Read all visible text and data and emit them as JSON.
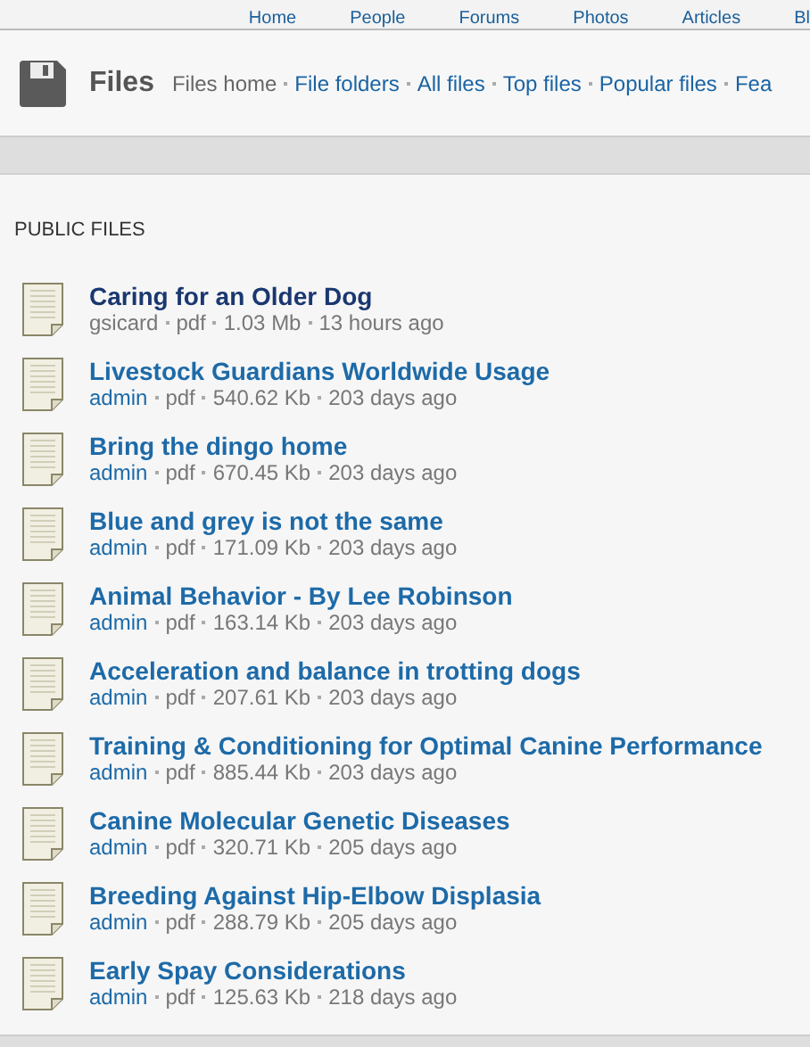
{
  "top_nav": [
    "Home",
    "People",
    "Forums",
    "Photos",
    "Articles",
    "Bl"
  ],
  "header": {
    "title": "Files",
    "links": [
      {
        "label": "Files home",
        "selected": true
      },
      {
        "label": "File folders",
        "selected": false
      },
      {
        "label": "All files",
        "selected": false
      },
      {
        "label": "Top files",
        "selected": false
      },
      {
        "label": "Popular files",
        "selected": false
      },
      {
        "label": "Fea",
        "selected": false
      }
    ]
  },
  "section_title": "PUBLIC FILES",
  "files": [
    {
      "title": "Caring for an Older Dog",
      "visited": true,
      "author": "gsicard",
      "author_link": false,
      "type": "pdf",
      "size": "1.03 Mb",
      "age": "13 hours ago"
    },
    {
      "title": "Livestock Guardians Worldwide Usage",
      "visited": false,
      "author": "admin",
      "author_link": true,
      "type": "pdf",
      "size": "540.62 Kb",
      "age": "203 days ago"
    },
    {
      "title": "Bring the dingo home",
      "visited": false,
      "author": "admin",
      "author_link": true,
      "type": "pdf",
      "size": "670.45 Kb",
      "age": "203 days ago"
    },
    {
      "title": "Blue and grey is not the same",
      "visited": false,
      "author": "admin",
      "author_link": true,
      "type": "pdf",
      "size": "171.09 Kb",
      "age": "203 days ago"
    },
    {
      "title": "Animal Behavior - By Lee Robinson",
      "visited": false,
      "author": "admin",
      "author_link": true,
      "type": "pdf",
      "size": "163.14 Kb",
      "age": "203 days ago"
    },
    {
      "title": "Acceleration and balance in trotting dogs",
      "visited": false,
      "author": "admin",
      "author_link": true,
      "type": "pdf",
      "size": "207.61 Kb",
      "age": "203 days ago"
    },
    {
      "title": "Training & Conditioning for Optimal Canine Performance",
      "visited": false,
      "author": "admin",
      "author_link": true,
      "type": "pdf",
      "size": "885.44 Kb",
      "age": "203 days ago"
    },
    {
      "title": "Canine Molecular Genetic Diseases",
      "visited": false,
      "author": "admin",
      "author_link": true,
      "type": "pdf",
      "size": "320.71 Kb",
      "age": "205 days ago"
    },
    {
      "title": "Breeding Against Hip-Elbow Displasia",
      "visited": false,
      "author": "admin",
      "author_link": true,
      "type": "pdf",
      "size": "288.79 Kb",
      "age": "205 days ago"
    },
    {
      "title": "Early Spay Considerations",
      "visited": false,
      "author": "admin",
      "author_link": true,
      "type": "pdf",
      "size": "125.63 Kb",
      "age": "218 days ago"
    }
  ]
}
